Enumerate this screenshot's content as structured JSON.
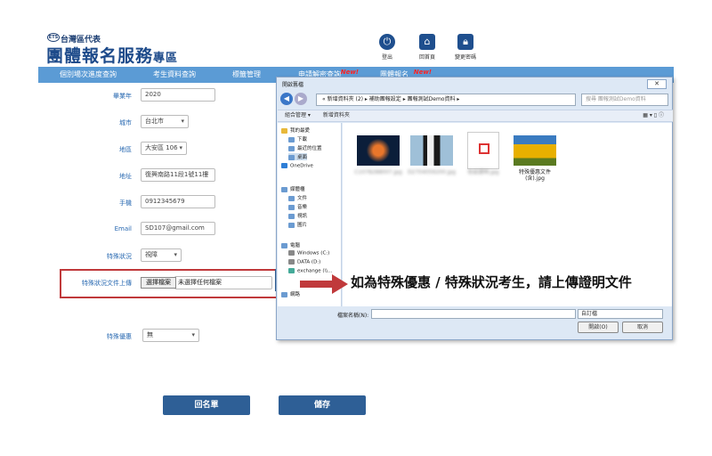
{
  "header": {
    "badge": "ETS",
    "subtitle": "台灣區代表",
    "title": "團體報名服務",
    "title_suffix": "專區",
    "icons": [
      {
        "label": "登出",
        "icon": "power-icon"
      },
      {
        "label": "回首頁",
        "icon": "home-icon"
      },
      {
        "label": "變更密碼",
        "icon": "lock-icon"
      }
    ]
  },
  "nav": {
    "items": [
      {
        "label": "個別場次進度查詢",
        "badge": ""
      },
      {
        "label": "考生資料查詢",
        "badge": ""
      },
      {
        "label": "標籤管理",
        "badge": ""
      },
      {
        "label": "申請解密查詢",
        "badge": "New!"
      },
      {
        "label": "團體報名",
        "badge": "New!"
      }
    ]
  },
  "form": {
    "year_label": "畢業年",
    "year_value": "2020",
    "city_label": "城市",
    "city_value": "台北市",
    "district_label": "地區",
    "district_value": "大安區 106",
    "address_label": "地址",
    "address_value": "復興南路11段1號11樓",
    "phone_label": "手機",
    "phone_value": "0912345679",
    "email_label": "Email",
    "email_value": "SD107@gmail.com",
    "special_label": "特殊狀況",
    "special_value": "視障",
    "upload_label": "特殊狀況文件上傳",
    "upload_button": "選擇檔案",
    "upload_status": "未選擇任何檔案",
    "discount_label": "特殊優惠",
    "discount_value": "無",
    "back_button": "回名單",
    "save_button": "儲存"
  },
  "dialog": {
    "title": "開啟舊檔",
    "close": "✕",
    "address_path": "« 新增資料夾 (2) ▸ 補助團報設定 ▸ 團報測試Demo資料 ▸",
    "search_placeholder": "搜尋 團報測試Demo資料",
    "toolbar_organize": "組合管理 ▾",
    "toolbar_new_folder": "新增資料夾",
    "sidebar": [
      {
        "label": "我的最愛",
        "icon": "star-icon"
      },
      {
        "label": "下載",
        "icon": "download-icon"
      },
      {
        "label": "最近的位置",
        "icon": "recent-icon"
      },
      {
        "label": "桌面",
        "icon": "desktop-icon"
      },
      {
        "label": "OneDrive",
        "icon": "cloud-icon"
      },
      {
        "label": "媒體櫃",
        "icon": "library-icon"
      },
      {
        "label": "文件",
        "icon": "document-icon"
      },
      {
        "label": "音樂",
        "icon": "music-icon"
      },
      {
        "label": "視訊",
        "icon": "video-icon"
      },
      {
        "label": "圖片",
        "icon": "picture-icon"
      },
      {
        "label": "電腦",
        "icon": "computer-icon"
      },
      {
        "label": "Windows (C:)",
        "icon": "drive-icon"
      },
      {
        "label": "DATA (D:)",
        "icon": "drive-icon"
      },
      {
        "label": "exchange (\\\\...",
        "icon": "network-drive-icon"
      },
      {
        "label": "網路",
        "icon": "network-icon"
      }
    ],
    "files": [
      {
        "name": "C1078288007.jpg",
        "blurred": true
      },
      {
        "name": "D2704059200.jpg",
        "blurred": true
      },
      {
        "name": "佐証證明.jpg",
        "blurred": true
      },
      {
        "name": "特殊優惠文件(含).jpg",
        "blurred": false
      }
    ],
    "filename_label": "檔案名稱(N):",
    "filetype_value": "自訂檔",
    "open_button": "開啟(O)",
    "cancel_button": "取消"
  },
  "callout": "如為特殊優惠 / 特殊狀況考生，請上傳證明文件",
  "colors": {
    "brand": "#1d4a8a",
    "nav": "#5b9bd5",
    "button": "#2e5f96",
    "highlight": "#c0393b"
  }
}
